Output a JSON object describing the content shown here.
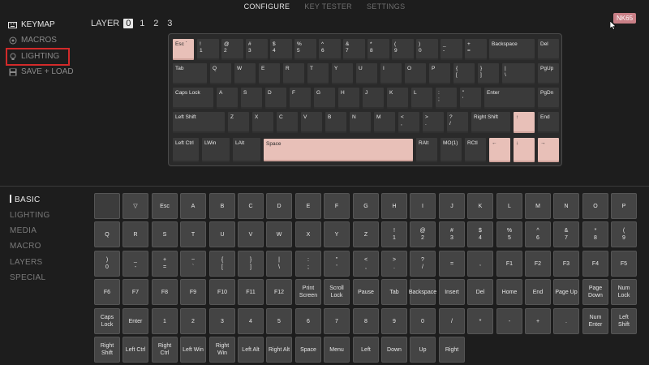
{
  "topnav": {
    "configure": "CONFIGURE",
    "key_tester": "KEY TESTER",
    "settings": "SETTINGS"
  },
  "sidebar_top": {
    "keymap": "KEYMAP",
    "macros": "MACROS",
    "lighting": "LIGHTING",
    "save_load": "SAVE + LOAD"
  },
  "layer": {
    "label": "LAYER",
    "options": [
      "0",
      "1",
      "2",
      "3"
    ],
    "selected": "0"
  },
  "keyboard_name": "NK65",
  "keyboard": {
    "row1": [
      "Esc `",
      "!\n1",
      "@\n2",
      "#\n3",
      "$\n4",
      "%\n5",
      "^\n6",
      "&\n7",
      "*\n8",
      "(\n9",
      ")\n0",
      "_\n-",
      "+\n=",
      "Backspace",
      "Del"
    ],
    "row2": [
      "Tab",
      "Q",
      "W",
      "E",
      "R",
      "T",
      "Y",
      "U",
      "I",
      "O",
      "P",
      "{\n[",
      "}\n]",
      "|\n\\",
      "PgUp"
    ],
    "row3": [
      "Caps Lock",
      "A",
      "S",
      "D",
      "F",
      "G",
      "H",
      "J",
      "K",
      "L",
      ":\n;",
      "\"\n'",
      "Enter",
      "PgDn"
    ],
    "row4": [
      "Left Shift",
      "Z",
      "X",
      "C",
      "V",
      "B",
      "N",
      "M",
      "<\n,",
      ">\n.",
      "?\n/",
      "Right Shift",
      "↑",
      "End"
    ],
    "row5": [
      "Left Ctrl",
      "LWin",
      "LAlt",
      "Space",
      "RAlt",
      "MO(1)",
      "RCtl",
      "←",
      "↓",
      "→"
    ]
  },
  "sidebar_bottom": {
    "basic": "BASIC",
    "lighting": "LIGHTING",
    "media": "MEDIA",
    "macro": "MACRO",
    "layers": "LAYERS",
    "special": "SPECIAL"
  },
  "basic_keys": [
    [
      "",
      "▽",
      "Esc",
      "A",
      "B",
      "C",
      "D",
      "E",
      "F",
      "G",
      "H",
      "I",
      "J",
      "K",
      "L",
      "M",
      "N",
      "O",
      "P"
    ],
    [
      "Q",
      "R",
      "S",
      "T",
      "U",
      "V",
      "W",
      "X",
      "Y",
      "Z",
      "!\n1",
      "@\n2",
      "#\n3",
      "$\n4",
      "%\n5",
      "^\n6",
      "&\n7",
      "*\n8",
      "(\n9"
    ],
    [
      ")\n0",
      "_\n-",
      "+\n=",
      "~\n`",
      "{\n[",
      "}\n]",
      "|\n\\",
      ":\n;",
      "\"\n'",
      "<\n,",
      ">\n.",
      "?\n/",
      "=",
      ",",
      "F1",
      "F2",
      "F3",
      "F4",
      "F5"
    ],
    [
      "F6",
      "F7",
      "F8",
      "F9",
      "F10",
      "F11",
      "F12",
      "Print\nScreen",
      "Scroll\nLock",
      "Pause",
      "Tab",
      "Backspace",
      "Insert",
      "Del",
      "Home",
      "End",
      "Page Up",
      "Page\nDown",
      "Num\nLock"
    ],
    [
      "Caps\nLock",
      "Enter",
      "1",
      "2",
      "3",
      "4",
      "5",
      "6",
      "7",
      "8",
      "9",
      "0",
      "/",
      "*",
      "-",
      "+",
      ".",
      "Num\nEnter",
      "Left\nShift"
    ],
    [
      "Right\nShift",
      "Left Ctrl",
      "Right\nCtrl",
      "Left Win",
      "Right\nWin",
      "Left Alt",
      "Right Alt",
      "Space",
      "Menu",
      "Left",
      "Down",
      "Up",
      "Right"
    ]
  ],
  "colors": {
    "accent_key": "#e8c0b8",
    "keyboard_badge": "#c97f86",
    "highlight_box": "#d22a2a"
  },
  "icons": {
    "keymap": "keyboard-icon",
    "macros": "circle-dot-icon",
    "lighting": "bulb-icon",
    "save_load": "save-icon"
  }
}
